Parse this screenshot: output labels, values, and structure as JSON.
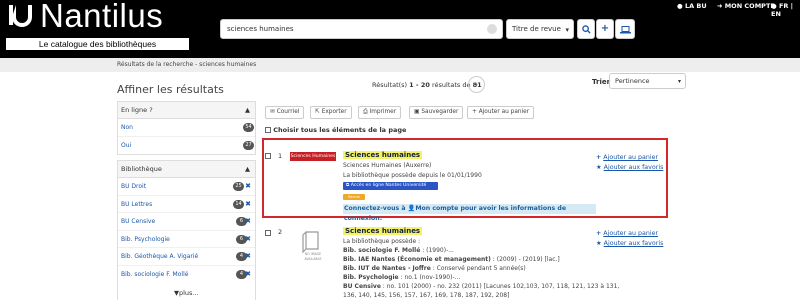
{
  "header": {
    "logo_text": "Nantilus",
    "logo_subtitle": "Le catalogue des bibliothèques",
    "search_value": "sciences humaines",
    "search_type": "Titre de revue",
    "top_links": [
      "LA BU",
      "MON COMPTE",
      "FR | EN"
    ]
  },
  "breadcrumb": "Résultats de la recherche - sciences humaines",
  "results": {
    "count_prefix": "Résultat(s) ",
    "count_range": "1 - 20",
    "count_mid": " résultats de ",
    "count_total": "81",
    "sort_label": "Trier",
    "sort_value": "Pertinence"
  },
  "sidebar": {
    "title": "Affiner les résultats",
    "online": {
      "title": "En ligne ?",
      "items": [
        {
          "label": "Non",
          "count": "54"
        },
        {
          "label": "Oui",
          "count": "27"
        }
      ]
    },
    "library": {
      "title": "Bibliothèque",
      "items": [
        {
          "label": "BU Droit",
          "count": "25"
        },
        {
          "label": "BU Lettres",
          "count": "14"
        },
        {
          "label": "BU Censive",
          "count": "6"
        },
        {
          "label": "Bib. Psychologie",
          "count": "6"
        },
        {
          "label": "Bib. Géothèque A. Vigarié",
          "count": "4"
        },
        {
          "label": "Bib. sociologie F. Mollé",
          "count": "4"
        }
      ]
    },
    "more_label": "plus..."
  },
  "toolbar": {
    "courriel": "Courriel",
    "exporter": "Exporter",
    "imprimer": "Imprimer",
    "sauvegarder": "Sauvegarder",
    "ajouter": "Ajouter au panier",
    "choose_all": "Choisir tous les éléments de la page"
  },
  "record1": {
    "number": "1",
    "logo_text": "Sciences Humaines",
    "title": "Sciences humaines",
    "subtitle": "Sciences Humaines (Auxerre)",
    "holding": "La bibliothèque possède depuis le 01/01/1990",
    "access_tag": "Accès en ligne Nantes Université",
    "type_tag": "Revue",
    "connect_prefix": "Connectez-vous à ",
    "connect_link": "Mon compte",
    "connect_suffix": " pour avoir les informations de connexion.",
    "add_cart": "Ajouter au panier",
    "add_fav": "Ajouter aux favoris"
  },
  "record2": {
    "number": "2",
    "noimage": "NO IMAGE AVAILABLE",
    "title": "Sciences humaines",
    "holding": "La bibliothèque possède :",
    "lines": [
      {
        "lib": "Bib. sociologie F. Mollé",
        "text": " : (1990)-..."
      },
      {
        "lib": "Bib. IAE Nantes (Économie et management)",
        "text": " : (2009) - (2019) [lac.]"
      },
      {
        "lib": "Bib. IUT de Nantes - Joffre",
        "text": " : Conservé pendant 5 année(s)"
      },
      {
        "lib": "Bib. Psychologie",
        "text": " : no.1 (nov-1990)-..."
      },
      {
        "lib": "BU Censive",
        "text": " : no. 101 (2000) - no. 232 (2011) [Lacunes 102,103, 107, 118, 121, 123 à 131,"
      },
      {
        "lib": "",
        "text": "136, 140, 145, 156, 157, 167, 169, 178, 187, 192, 208]"
      }
    ],
    "add_cart": "Ajouter au panier",
    "add_fav": "Ajouter aux favoris"
  },
  "colors": {
    "header_bg": "#000000",
    "link": "#1a57a8",
    "highlight": "#f4f26a",
    "selection_border": "#d0282b",
    "access_tag": "#2b55c4",
    "type_tag": "#f0a829"
  }
}
